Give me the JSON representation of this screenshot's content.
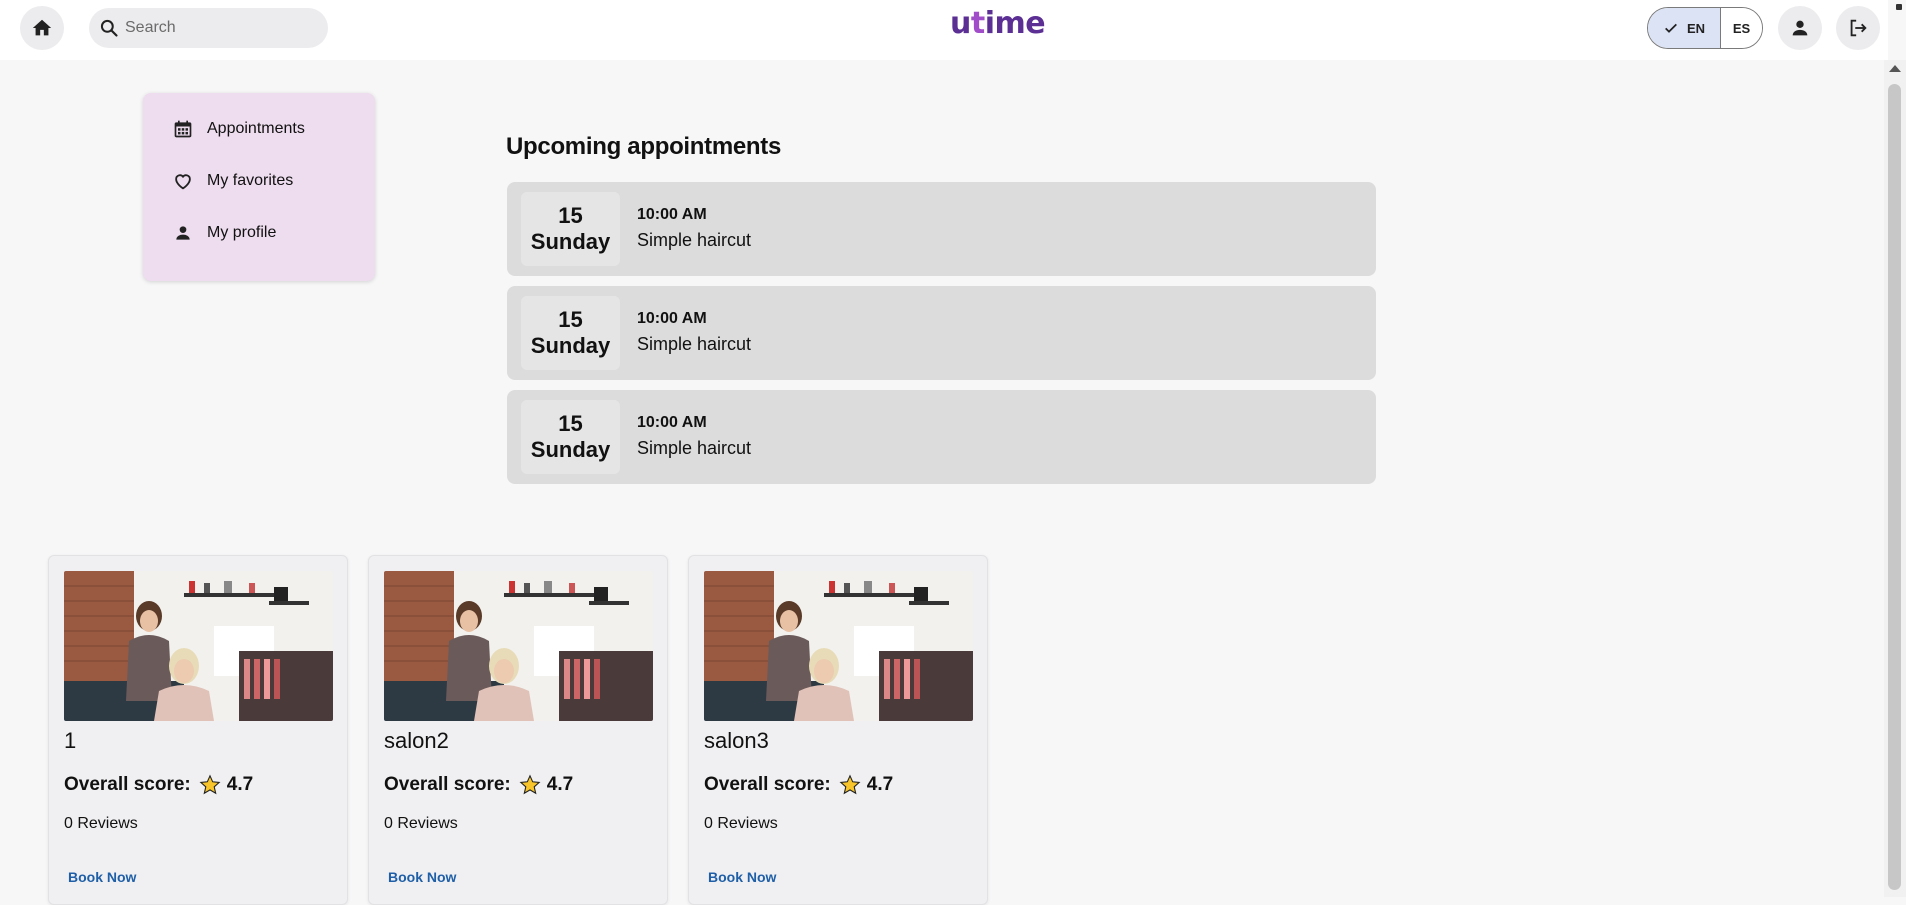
{
  "header": {
    "search_placeholder": "Search",
    "logo": {
      "u": "u",
      "t": "t",
      "rest": "ime"
    },
    "lang_en": "EN",
    "lang_es": "ES"
  },
  "sidemenu": {
    "items": [
      {
        "label": "Appointments",
        "icon": "calendar-icon"
      },
      {
        "label": "My favorites",
        "icon": "heart-icon"
      },
      {
        "label": "My profile",
        "icon": "person-icon"
      }
    ]
  },
  "appointments": {
    "title": "Upcoming appointments",
    "items": [
      {
        "day": "15",
        "weekday": "Sunday",
        "time": "10:00 AM",
        "service": "Simple haircut"
      },
      {
        "day": "15",
        "weekday": "Sunday",
        "time": "10:00 AM",
        "service": "Simple haircut"
      },
      {
        "day": "15",
        "weekday": "Sunday",
        "time": "10:00 AM",
        "service": "Simple haircut"
      }
    ]
  },
  "salons": [
    {
      "name": "1",
      "score_label": "Overall score:",
      "score": "4.7",
      "reviews": "0 Reviews",
      "book": "Book Now"
    },
    {
      "name": "salon2",
      "score_label": "Overall score:",
      "score": "4.7",
      "reviews": "0 Reviews",
      "book": "Book Now"
    },
    {
      "name": "salon3",
      "score_label": "Overall score:",
      "score": "4.7",
      "reviews": "0 Reviews",
      "book": "Book Now"
    }
  ],
  "colors": {
    "brand": "#5b2f94",
    "menu_bg": "#eedcef",
    "appt_bg": "#dcdcdc",
    "link": "#1f5fa8"
  }
}
